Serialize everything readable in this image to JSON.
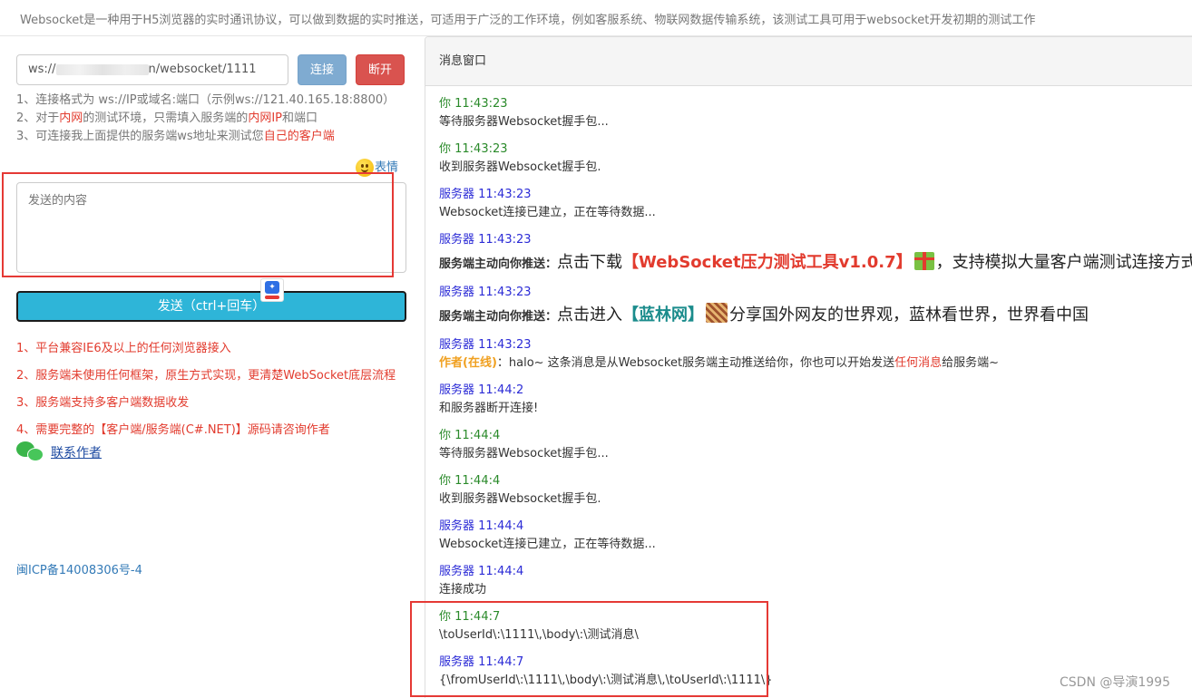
{
  "header": {
    "intro": "Websocket是一种用于H5浏览器的实时通讯协议，可以做到数据的实时推送，可适用于广泛的工作环境，例如客服系统、物联网数据传输系统，该测试工具可用于websocket开发初期的测试工作"
  },
  "connection": {
    "url_prefix": "ws://",
    "url_suffix": "n/websocket/1111",
    "connect_label": "连接",
    "disconnect_label": "断开"
  },
  "tips": [
    {
      "parts": [
        {
          "t": "1、连接格式为 ws://IP或域名:端口（示例ws://121.40.165.18:8800）",
          "red": false
        }
      ]
    },
    {
      "parts": [
        {
          "t": "2、对于",
          "red": false
        },
        {
          "t": "内网",
          "red": true
        },
        {
          "t": "的测试环境，只需填入服务端的",
          "red": false
        },
        {
          "t": "内网IP",
          "red": true
        },
        {
          "t": "和端口",
          "red": false
        }
      ]
    },
    {
      "parts": [
        {
          "t": "3、可连接我上面提供的服务端ws地址来测试您",
          "red": false
        },
        {
          "t": "自己的客户端",
          "red": true
        }
      ]
    }
  ],
  "emoji_label": "表情",
  "send": {
    "placeholder": "发送的内容",
    "button_label": "发送（ctrl+回车）"
  },
  "features": [
    "1、平台兼容IE6及以上的任何浏览器接入",
    "2、服务端未使用任何框架，原生方式实现，更清楚WebSocket底层流程",
    "3、服务端支持多客户端数据收发",
    "4、需要完整的【客户端/服务端(C#.NET)】源码请咨询作者"
  ],
  "contact_label": "联系作者",
  "icp": "闽ICP备14008306号-4",
  "panel": {
    "title": "消息窗口",
    "messages": [
      {
        "who": "你 11:43:23",
        "role": "me",
        "text": "等待服务器Websocket握手包..."
      },
      {
        "who": "你 11:43:23",
        "role": "me",
        "text": "收到服务器Websocket握手包."
      },
      {
        "who": "服务器 11:43:23",
        "role": "srv",
        "text": "Websocket连接已建立，正在等待数据..."
      },
      {
        "who": "服务器 11:43:23",
        "role": "srv",
        "kind": "push1",
        "label": "服务端主动向你推送：",
        "pre": "点击下载",
        "link": "【WebSocket压力测试工具v1.0.7】",
        "post": "，支持模拟大量客户端测试连接方式"
      },
      {
        "who": "服务器 11:43:23",
        "role": "srv",
        "kind": "push2",
        "label": "服务端主动向你推送：",
        "pre": "点击进入",
        "link": "【蓝林网】",
        "post": "分享国外网友的世界观，蓝林看世界，世界看中国"
      },
      {
        "who": "服务器 11:43:23",
        "role": "srv",
        "kind": "author",
        "author": "作者(在线)",
        "pre": "：halo~ 这条消息是从Websocket服务端主动推送给你，你也可以开始发送",
        "red": "任何消息",
        "post": "给服务端~"
      },
      {
        "who": "服务器 11:44:2",
        "role": "srv",
        "text": "和服务器断开连接!"
      },
      {
        "who": "你 11:44:4",
        "role": "me",
        "text": "等待服务器Websocket握手包..."
      },
      {
        "who": "你 11:44:4",
        "role": "me",
        "text": "收到服务器Websocket握手包."
      },
      {
        "who": "服务器 11:44:4",
        "role": "srv",
        "text": "Websocket连接已建立，正在等待数据..."
      },
      {
        "who": "服务器 11:44:4",
        "role": "srv",
        "text": "连接成功"
      },
      {
        "who": "你 11:44:7",
        "role": "me",
        "text": "\\toUserId\\:\\1111\\,\\body\\:\\测试消息\\"
      },
      {
        "who": "服务器 11:44:7",
        "role": "srv",
        "text": "{\\fromUserId\\:\\1111\\,\\body\\:\\测试消息\\,\\toUserId\\:\\1111\\}"
      }
    ]
  },
  "watermark": "CSDN @导演1995"
}
